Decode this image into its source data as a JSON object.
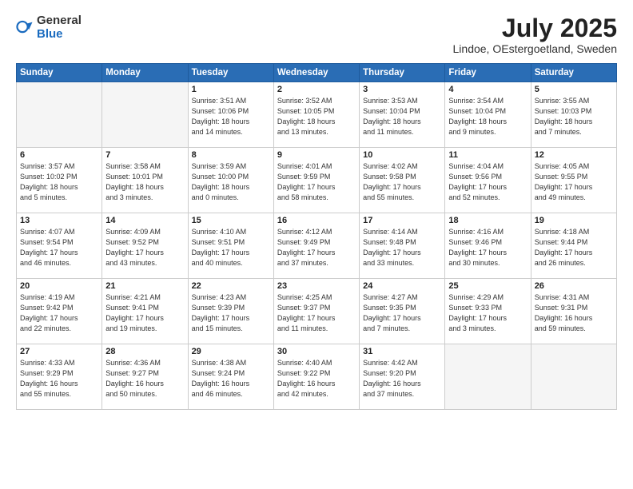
{
  "logo": {
    "general": "General",
    "blue": "Blue"
  },
  "title": "July 2025",
  "location": "Lindoe, OEstergoetland, Sweden",
  "days_of_week": [
    "Sunday",
    "Monday",
    "Tuesday",
    "Wednesday",
    "Thursday",
    "Friday",
    "Saturday"
  ],
  "weeks": [
    [
      {
        "day": "",
        "info": ""
      },
      {
        "day": "",
        "info": ""
      },
      {
        "day": "1",
        "info": "Sunrise: 3:51 AM\nSunset: 10:06 PM\nDaylight: 18 hours\nand 14 minutes."
      },
      {
        "day": "2",
        "info": "Sunrise: 3:52 AM\nSunset: 10:05 PM\nDaylight: 18 hours\nand 13 minutes."
      },
      {
        "day": "3",
        "info": "Sunrise: 3:53 AM\nSunset: 10:04 PM\nDaylight: 18 hours\nand 11 minutes."
      },
      {
        "day": "4",
        "info": "Sunrise: 3:54 AM\nSunset: 10:04 PM\nDaylight: 18 hours\nand 9 minutes."
      },
      {
        "day": "5",
        "info": "Sunrise: 3:55 AM\nSunset: 10:03 PM\nDaylight: 18 hours\nand 7 minutes."
      }
    ],
    [
      {
        "day": "6",
        "info": "Sunrise: 3:57 AM\nSunset: 10:02 PM\nDaylight: 18 hours\nand 5 minutes."
      },
      {
        "day": "7",
        "info": "Sunrise: 3:58 AM\nSunset: 10:01 PM\nDaylight: 18 hours\nand 3 minutes."
      },
      {
        "day": "8",
        "info": "Sunrise: 3:59 AM\nSunset: 10:00 PM\nDaylight: 18 hours\nand 0 minutes."
      },
      {
        "day": "9",
        "info": "Sunrise: 4:01 AM\nSunset: 9:59 PM\nDaylight: 17 hours\nand 58 minutes."
      },
      {
        "day": "10",
        "info": "Sunrise: 4:02 AM\nSunset: 9:58 PM\nDaylight: 17 hours\nand 55 minutes."
      },
      {
        "day": "11",
        "info": "Sunrise: 4:04 AM\nSunset: 9:56 PM\nDaylight: 17 hours\nand 52 minutes."
      },
      {
        "day": "12",
        "info": "Sunrise: 4:05 AM\nSunset: 9:55 PM\nDaylight: 17 hours\nand 49 minutes."
      }
    ],
    [
      {
        "day": "13",
        "info": "Sunrise: 4:07 AM\nSunset: 9:54 PM\nDaylight: 17 hours\nand 46 minutes."
      },
      {
        "day": "14",
        "info": "Sunrise: 4:09 AM\nSunset: 9:52 PM\nDaylight: 17 hours\nand 43 minutes."
      },
      {
        "day": "15",
        "info": "Sunrise: 4:10 AM\nSunset: 9:51 PM\nDaylight: 17 hours\nand 40 minutes."
      },
      {
        "day": "16",
        "info": "Sunrise: 4:12 AM\nSunset: 9:49 PM\nDaylight: 17 hours\nand 37 minutes."
      },
      {
        "day": "17",
        "info": "Sunrise: 4:14 AM\nSunset: 9:48 PM\nDaylight: 17 hours\nand 33 minutes."
      },
      {
        "day": "18",
        "info": "Sunrise: 4:16 AM\nSunset: 9:46 PM\nDaylight: 17 hours\nand 30 minutes."
      },
      {
        "day": "19",
        "info": "Sunrise: 4:18 AM\nSunset: 9:44 PM\nDaylight: 17 hours\nand 26 minutes."
      }
    ],
    [
      {
        "day": "20",
        "info": "Sunrise: 4:19 AM\nSunset: 9:42 PM\nDaylight: 17 hours\nand 22 minutes."
      },
      {
        "day": "21",
        "info": "Sunrise: 4:21 AM\nSunset: 9:41 PM\nDaylight: 17 hours\nand 19 minutes."
      },
      {
        "day": "22",
        "info": "Sunrise: 4:23 AM\nSunset: 9:39 PM\nDaylight: 17 hours\nand 15 minutes."
      },
      {
        "day": "23",
        "info": "Sunrise: 4:25 AM\nSunset: 9:37 PM\nDaylight: 17 hours\nand 11 minutes."
      },
      {
        "day": "24",
        "info": "Sunrise: 4:27 AM\nSunset: 9:35 PM\nDaylight: 17 hours\nand 7 minutes."
      },
      {
        "day": "25",
        "info": "Sunrise: 4:29 AM\nSunset: 9:33 PM\nDaylight: 17 hours\nand 3 minutes."
      },
      {
        "day": "26",
        "info": "Sunrise: 4:31 AM\nSunset: 9:31 PM\nDaylight: 16 hours\nand 59 minutes."
      }
    ],
    [
      {
        "day": "27",
        "info": "Sunrise: 4:33 AM\nSunset: 9:29 PM\nDaylight: 16 hours\nand 55 minutes."
      },
      {
        "day": "28",
        "info": "Sunrise: 4:36 AM\nSunset: 9:27 PM\nDaylight: 16 hours\nand 50 minutes."
      },
      {
        "day": "29",
        "info": "Sunrise: 4:38 AM\nSunset: 9:24 PM\nDaylight: 16 hours\nand 46 minutes."
      },
      {
        "day": "30",
        "info": "Sunrise: 4:40 AM\nSunset: 9:22 PM\nDaylight: 16 hours\nand 42 minutes."
      },
      {
        "day": "31",
        "info": "Sunrise: 4:42 AM\nSunset: 9:20 PM\nDaylight: 16 hours\nand 37 minutes."
      },
      {
        "day": "",
        "info": ""
      },
      {
        "day": "",
        "info": ""
      }
    ]
  ]
}
